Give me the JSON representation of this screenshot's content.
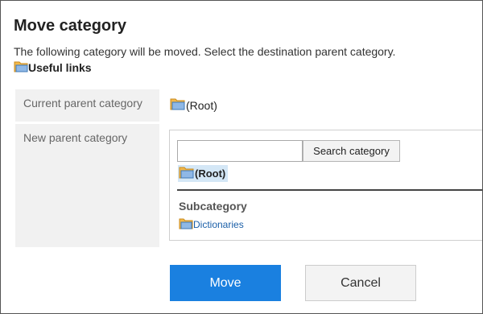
{
  "dialog": {
    "title": "Move category",
    "description": "The following category will be moved. Select the destination parent category.",
    "target_category": "Useful links"
  },
  "form": {
    "current_parent_label": "Current parent category",
    "current_parent_value": "(Root)",
    "new_parent_label": "New parent category"
  },
  "picker": {
    "search_input_value": "",
    "search_button_label": "Search category",
    "selected_node": "(Root)",
    "subcategory_heading": "Subcategory",
    "subcategories": [
      "Dictionaries"
    ]
  },
  "actions": {
    "move_label": "Move",
    "cancel_label": "Cancel"
  },
  "colors": {
    "primary_button": "#1a80e0",
    "selected_highlight": "#d4e7f6",
    "link": "#1a5fa8",
    "folder": "#f2b84b"
  },
  "icons": {
    "folder": "folder-icon"
  }
}
